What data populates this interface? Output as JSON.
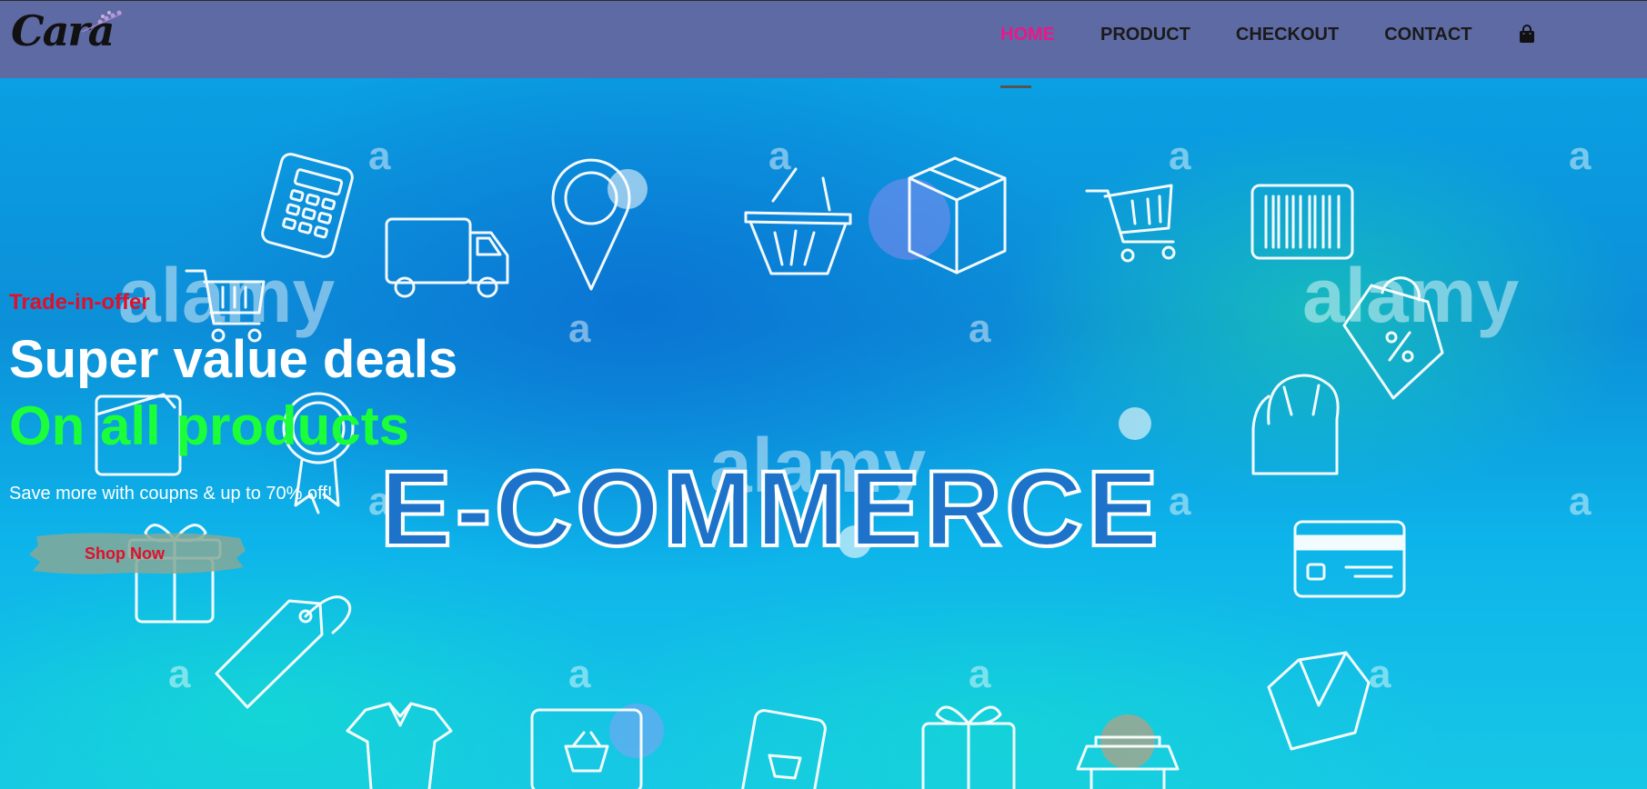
{
  "header": {
    "logo_text": "Cara",
    "nav": {
      "home": "HOME",
      "product": "PRODUCT",
      "checkout": "CHECKOUT",
      "contact": "CONTACT"
    },
    "cart_icon": "shopping-bag-icon"
  },
  "hero": {
    "eyebrow": "Trade-in-offer",
    "headline": "Super value deals",
    "headline_accent": "On all products",
    "subtext": "Save more with coupns & up to 70% off!",
    "cta_label": "Shop Now",
    "banner_text": "E-COMMERCE",
    "watermark_text": "alamy",
    "watermark_mark": "a"
  },
  "colors": {
    "header_bg": "#5e6aa3",
    "nav_active": "#e8188b",
    "eyebrow": "#e0102a",
    "headline_accent": "#1aff3a",
    "cta_text": "#e0102a"
  }
}
